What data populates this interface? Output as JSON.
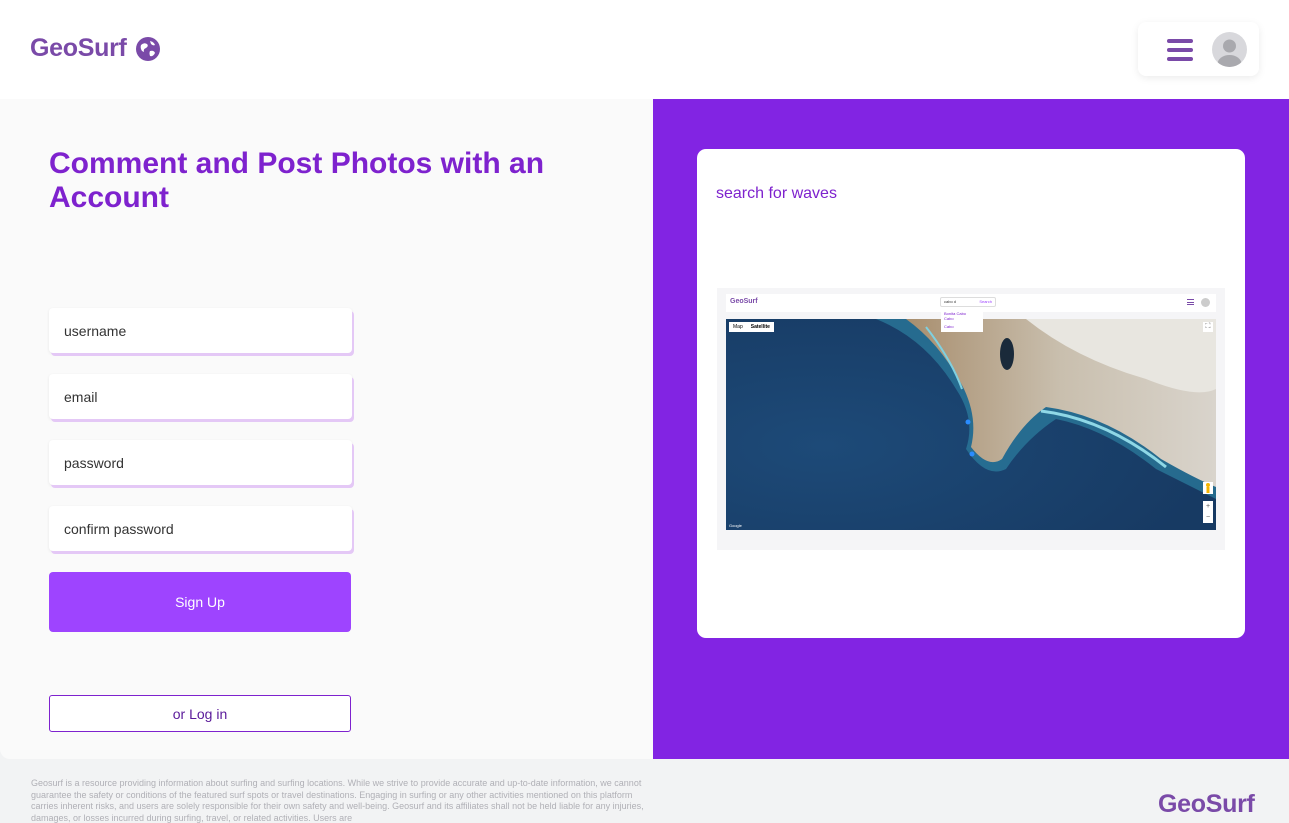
{
  "header": {
    "logo_text": "GeoSurf",
    "menu_icon": "hamburger-menu-icon",
    "avatar_icon": "user-avatar-icon"
  },
  "signup_form": {
    "heading": "Comment and Post Photos with an Account",
    "username_placeholder": "username",
    "email_placeholder": "email",
    "password_placeholder": "password",
    "confirm_password_placeholder": "confirm password",
    "signup_button": "Sign Up",
    "login_button": "or Log in"
  },
  "promo_card": {
    "title": "search for waves",
    "preview": {
      "logo_text": "GeoSurf",
      "search_value": "cabo d",
      "search_button": "Search",
      "dropdown_items": [
        "Bonita Cabo",
        "Cabo",
        "Cabo"
      ],
      "map_tabs": [
        "Map",
        "Satellite"
      ],
      "active_map_tab": "Satellite",
      "attribution": "Google"
    }
  },
  "footer": {
    "disclaimer": "Geosurf is a resource providing information about surfing and surfing locations. While we strive to provide accurate and up-to-date information, we cannot guarantee the safety or conditions of the featured surf spots or travel destinations. Engaging in surfing or any other activities mentioned on this platform carries inherent risks, and users are solely responsible for their own safety and well-being. Geosurf and its affiliates shall not be held liable for any injuries, damages, or losses incurred during surfing, travel, or related activities. Users are",
    "logo_text": "GeoSurf"
  },
  "colors": {
    "brand_purple": "#7a4aa8",
    "accent_purple": "#8224e3",
    "button_purple": "#9e44ff",
    "heading_purple": "#7e22ce"
  }
}
